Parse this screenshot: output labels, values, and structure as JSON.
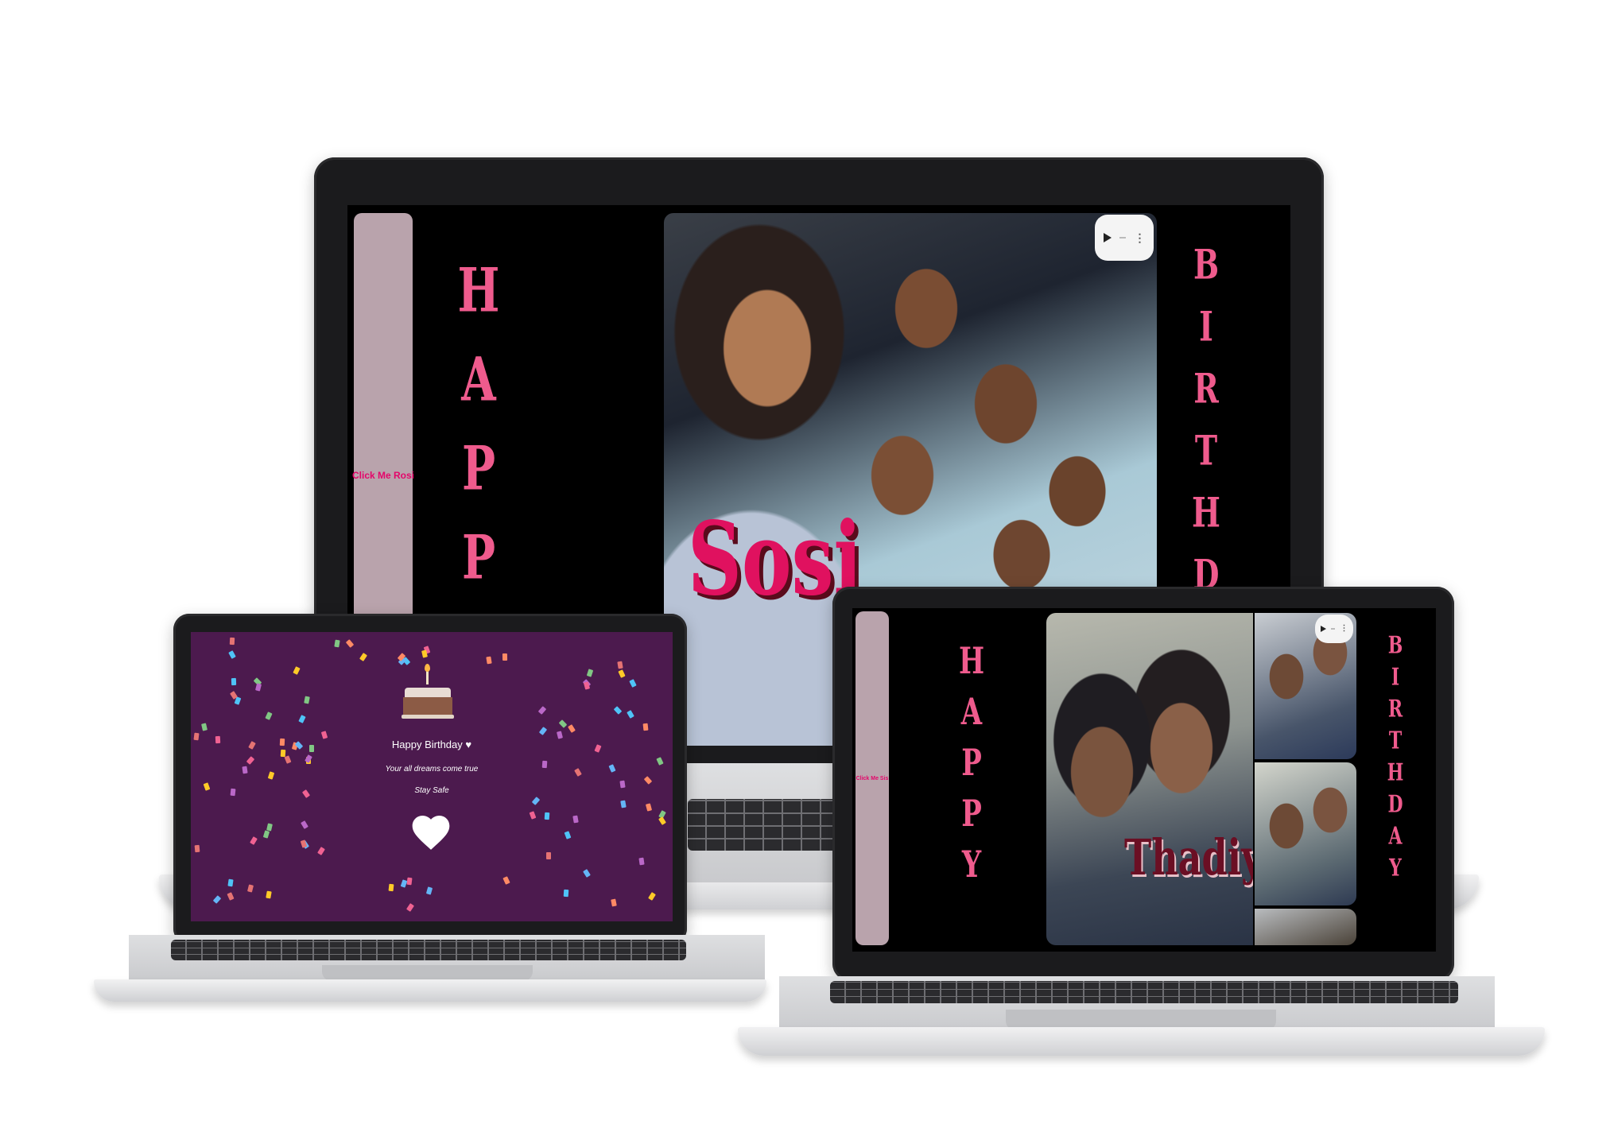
{
  "desktop_slide": {
    "side_link": "Click Me Rosi",
    "left_letters": [
      "H",
      "A",
      "P",
      "P"
    ],
    "right_letters": [
      "B",
      "I",
      "R",
      "T",
      "H",
      "D"
    ],
    "photo_name": "Sosi"
  },
  "right_slide": {
    "side_link": "Click Me Sis",
    "left_letters": [
      "H",
      "A",
      "P",
      "P",
      "Y"
    ],
    "right_letters": [
      "B",
      "I",
      "R",
      "T",
      "H",
      "D",
      "A",
      "Y"
    ],
    "photo_name": "Thadiyo"
  },
  "left_slide": {
    "greeting": "Happy Birthday ♥",
    "wish": "Your all dreams come true",
    "sign_off": "Stay Safe"
  },
  "player": {
    "play_icon": "play-icon",
    "menu_icon": "more-vertical-icon"
  },
  "colors": {
    "letter_pink": "#ef5b8d",
    "link_pink": "#e4066a",
    "side_panel": "#b9a3ac",
    "purple_bg": "#4c1a4e",
    "name_crimson": "#e0115f",
    "name_maroon": "#6b0f24"
  }
}
